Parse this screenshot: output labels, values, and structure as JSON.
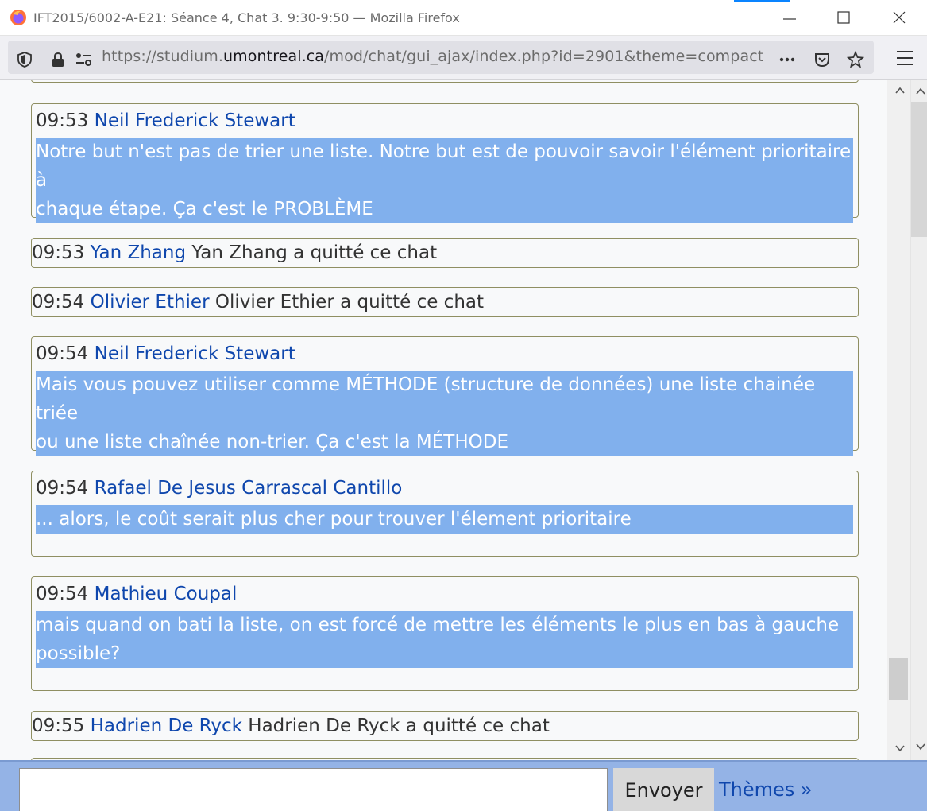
{
  "window": {
    "title": "IFT2015/6002-A-E21: Séance 4, Chat 3. 9:30-9:50 — Mozilla Firefox"
  },
  "urlbar": {
    "prefix": "https://studium.",
    "domain": "umontreal.ca",
    "path": "/mod/chat/gui_ajax/index.php?id=2901&theme=compact"
  },
  "messages": [
    {
      "type": "message",
      "time": "09:53",
      "user": "Neil Frederick Stewart",
      "lines": [
        "Notre but n'est pas de trier une liste. Notre but est de pouvoir savoir l'élément prioritaire à",
        "chaque étape. Ça c'est le PROBLÈME"
      ]
    },
    {
      "type": "system",
      "time": "09:53",
      "user": "Yan Zhang",
      "text": "Yan Zhang a quitté ce chat"
    },
    {
      "type": "system",
      "time": "09:54",
      "user": "Olivier Ethier",
      "text": "Olivier Ethier a quitté ce chat"
    },
    {
      "type": "message",
      "time": "09:54",
      "user": "Neil Frederick Stewart",
      "lines": [
        "Mais vous pouvez utiliser comme MÉTHODE (structure de données) une liste chainée triée",
        "ou une liste chaînée non-trier. Ça c'est la MÉTHODE"
      ]
    },
    {
      "type": "message",
      "time": "09:54",
      "user": "Rafael De Jesus Carrascal Cantillo",
      "lines": [
        "... alors, le coût serait plus cher pour trouver l'élement prioritaire"
      ]
    },
    {
      "type": "message",
      "time": "09:54",
      "user": "Mathieu Coupal",
      "lines": [
        "mais quand on bati la liste, on est forcé de mettre les éléments le plus en bas à gauche",
        "possible?"
      ]
    },
    {
      "type": "system",
      "time": "09:55",
      "user": "Hadrien De Ryck",
      "text": "Hadrien De Ryck a quitté ce chat"
    }
  ],
  "input": {
    "value": "",
    "send_label": "Envoyer",
    "themes_label": "Thèmes »"
  },
  "colors": {
    "highlight": "#81b0ed",
    "username": "#0f47ad",
    "inputbar": "#94b3e6"
  }
}
